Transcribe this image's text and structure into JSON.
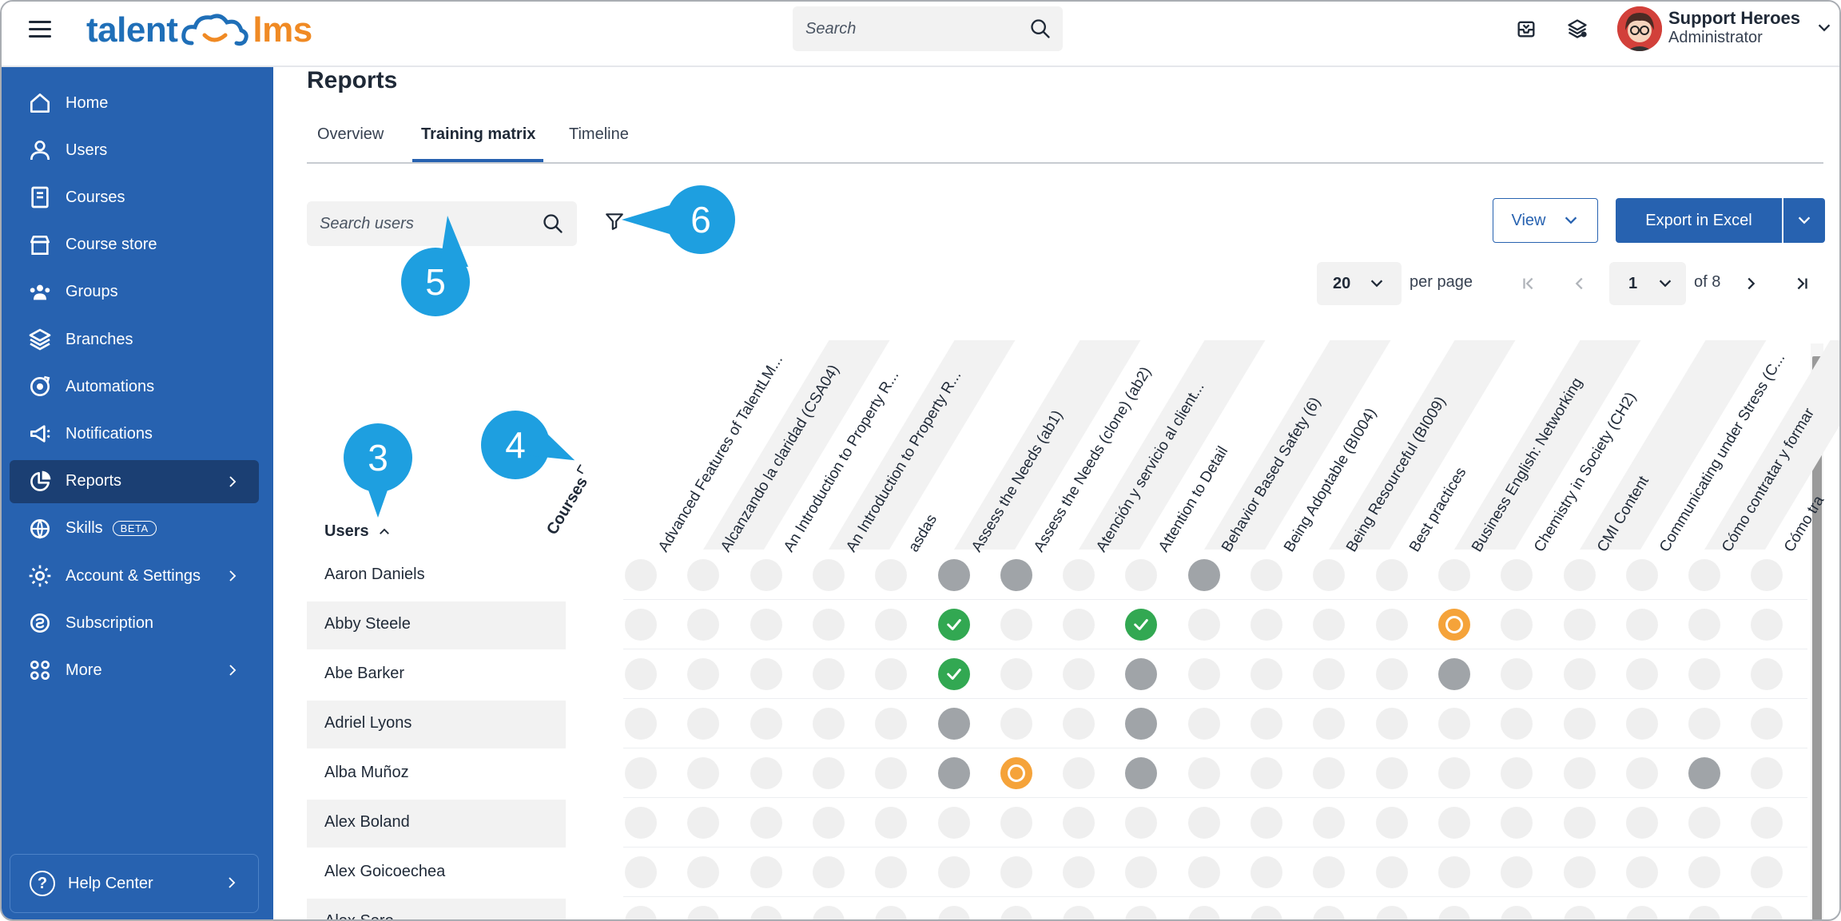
{
  "header": {
    "logo_left": "talent",
    "logo_right": "lms",
    "search_placeholder": "Search",
    "user_name": "Support Heroes",
    "user_role": "Administrator"
  },
  "sidebar": {
    "items": [
      {
        "label": "Home",
        "icon": "home-icon"
      },
      {
        "label": "Users",
        "icon": "user-icon"
      },
      {
        "label": "Courses",
        "icon": "book-icon"
      },
      {
        "label": "Course store",
        "icon": "store-icon"
      },
      {
        "label": "Groups",
        "icon": "groups-icon"
      },
      {
        "label": "Branches",
        "icon": "layers-icon"
      },
      {
        "label": "Automations",
        "icon": "automation-icon"
      },
      {
        "label": "Notifications",
        "icon": "megaphone-icon"
      },
      {
        "label": "Reports",
        "icon": "pie-chart-icon",
        "active": true
      },
      {
        "label": "Skills",
        "icon": "skills-icon",
        "badge": "BETA"
      },
      {
        "label": "Account & Settings",
        "icon": "gear-icon"
      },
      {
        "label": "Subscription",
        "icon": "subscription-icon"
      },
      {
        "label": "More",
        "icon": "grid-icon"
      }
    ],
    "help_label": "Help Center"
  },
  "page": {
    "title": "Reports",
    "tabs": [
      "Overview",
      "Training matrix",
      "Timeline"
    ],
    "active_tab": "Training matrix"
  },
  "toolbar": {
    "search_users_placeholder": "Search users",
    "view_label": "View",
    "export_label": "Export in Excel"
  },
  "pagination": {
    "per_page_value": "20",
    "per_page_label": "per page",
    "current_page": "1",
    "of_total": "of 8"
  },
  "matrix": {
    "users_header": "Users",
    "courses_header": "Courses",
    "courses": [
      "Advanced Features of TalentLM...",
      "Alcanzando la claridad (CSA04)",
      "An Introduction to Property R...",
      "An Introduction to Property R...",
      "asdas",
      "Assess the Needs (ab1)",
      "Assess the Needs (clone) (ab2)",
      "Atención y servicio al client...",
      "Attention to Detail",
      "Behavior Based Safety (6)",
      "Being Adoptable (BI004)",
      "Being Resourceful (BI009)",
      "Best practices",
      "Business English: Networking",
      "Chemistry in Society (CH2)",
      "CMI Content",
      "Communicating under Stress (C...",
      "Cómo contratar y formar",
      "Cómo tra"
    ],
    "users": [
      {
        "name": "Aaron Daniels",
        "cells": [
          "e",
          "e",
          "e",
          "e",
          "e",
          "g",
          "g",
          "e",
          "e",
          "g",
          "e",
          "e",
          "e",
          "e",
          "e",
          "e",
          "e",
          "e",
          "e"
        ]
      },
      {
        "name": "Abby Steele",
        "cells": [
          "e",
          "e",
          "e",
          "e",
          "e",
          "c",
          "e",
          "e",
          "c",
          "e",
          "e",
          "e",
          "e",
          "o",
          "e",
          "e",
          "e",
          "e",
          "e"
        ]
      },
      {
        "name": "Abe Barker",
        "cells": [
          "e",
          "e",
          "e",
          "e",
          "e",
          "c",
          "e",
          "e",
          "g",
          "e",
          "e",
          "e",
          "e",
          "g",
          "e",
          "e",
          "e",
          "e",
          "e"
        ]
      },
      {
        "name": "Adriel Lyons",
        "cells": [
          "e",
          "e",
          "e",
          "e",
          "e",
          "g",
          "e",
          "e",
          "g",
          "e",
          "e",
          "e",
          "e",
          "e",
          "e",
          "e",
          "e",
          "e",
          "e"
        ]
      },
      {
        "name": "Alba Muñoz",
        "cells": [
          "e",
          "e",
          "e",
          "e",
          "e",
          "g",
          "o",
          "e",
          "g",
          "e",
          "e",
          "e",
          "e",
          "e",
          "e",
          "e",
          "e",
          "g",
          "e"
        ]
      },
      {
        "name": "Alex Boland",
        "cells": [
          "e",
          "e",
          "e",
          "e",
          "e",
          "e",
          "e",
          "e",
          "e",
          "e",
          "e",
          "e",
          "e",
          "e",
          "e",
          "e",
          "e",
          "e",
          "e"
        ]
      },
      {
        "name": "Alex Goicoechea",
        "cells": [
          "e",
          "e",
          "e",
          "e",
          "e",
          "e",
          "e",
          "e",
          "e",
          "e",
          "e",
          "e",
          "e",
          "e",
          "e",
          "e",
          "e",
          "e",
          "e"
        ]
      },
      {
        "name": "Alex Sero",
        "cells": [
          "e",
          "e",
          "e",
          "e",
          "e",
          "e",
          "e",
          "e",
          "e",
          "e",
          "e",
          "e",
          "e",
          "e",
          "e",
          "e",
          "e",
          "e",
          "e"
        ]
      }
    ]
  },
  "callouts": [
    "3",
    "4",
    "5",
    "6"
  ],
  "colors": {
    "sidebar": "#2762b0",
    "sidebar_active": "#1b3f73",
    "completed": "#32a852",
    "in_progress": "#f5a33a",
    "not_started": "#a0a4a8",
    "not_enrolled": "#efefef",
    "callout": "#1e9fe0"
  }
}
